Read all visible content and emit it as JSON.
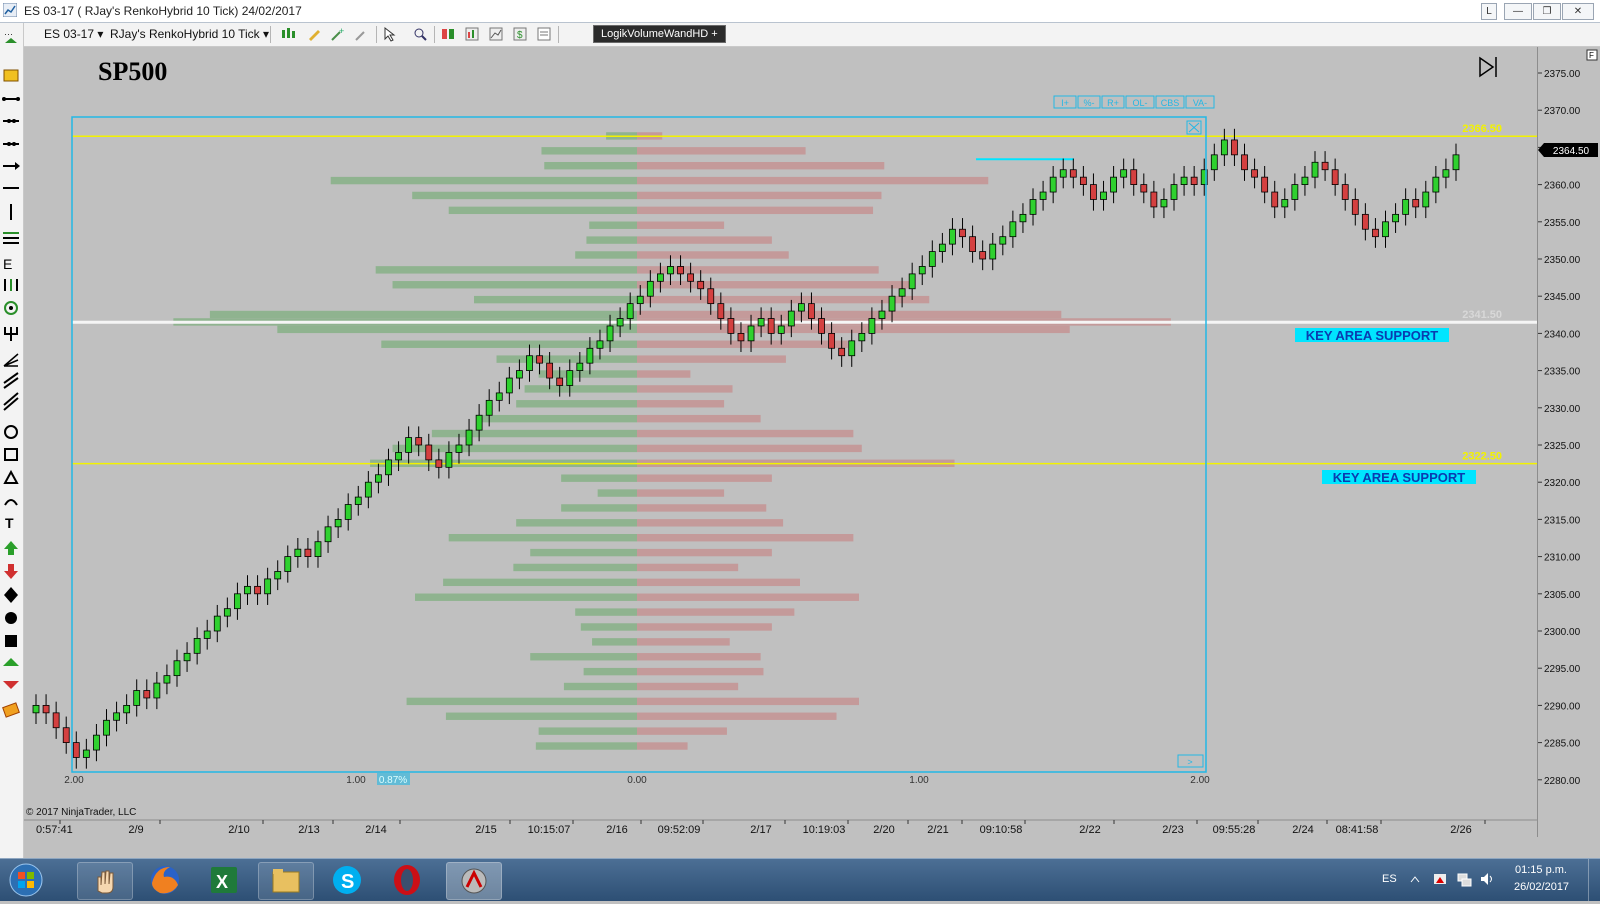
{
  "window": {
    "title": "ES 03-17 ( RJay's RenkoHybrid 10 Tick)  24/02/2017",
    "buttons": [
      "L",
      "—",
      "❐",
      "✕"
    ]
  },
  "toolbar": {
    "instrument": "ES 03-17",
    "bar_type": "RJay's RenkoHybrid 10 Tick",
    "indicator_button": "LogikVolumeWandHD +"
  },
  "colors": {
    "bull_candle": "#2fd12f",
    "bear_candle": "#d44040",
    "yellow_line": "#f2f200",
    "cyan_label": "#00e5ff",
    "profile_buy": "#8fb38f",
    "profile_sell": "#c49a9a",
    "box_border": "#23b7e5"
  },
  "chart": {
    "title": "SP500",
    "copyright": "© 2017 NinjaTrader, LLC",
    "y_axis_labels": [
      "2375.00",
      "2370.00",
      "2365.00",
      "2360.00",
      "2355.00",
      "2350.00",
      "2345.00",
      "2340.00",
      "2335.00",
      "2330.00",
      "2325.00",
      "2320.00",
      "2315.00",
      "2310.00",
      "2305.00",
      "2300.00",
      "2295.00",
      "2290.00",
      "2285.00",
      "2280.00"
    ],
    "y_range": [
      2280,
      2375
    ],
    "current_price": "2364.50",
    "levels": [
      {
        "price": 2366.5,
        "label": "2366.50",
        "color": "yellow"
      },
      {
        "price": 2341.5,
        "label": "2341.50",
        "color": "white"
      },
      {
        "price": 2322.5,
        "label": "2322.50",
        "color": "yellow"
      }
    ],
    "annotations": [
      "KEY AREA SUPPORT",
      "KEY AREA SUPPORT"
    ],
    "x_axis_labels": [
      "0:57:41",
      "2/9",
      "2/10",
      "2/13",
      "2/14",
      "2/15",
      "10:15:07",
      "2/16",
      "09:52:09",
      "2/17",
      "10:19:03",
      "2/20",
      "2/21",
      "09:10:58",
      "2/22",
      "2/23",
      "09:55:28",
      "2/24",
      "08:41:58",
      "2/26"
    ],
    "profile_buttons": [
      "I+",
      "%-",
      "R+",
      "OL-",
      "CBS",
      "VA-"
    ],
    "profile_scale_labels": [
      "2.00",
      "1.00",
      "0.87%",
      "0.00",
      "1.00",
      "2.00"
    ],
    "profile_nav": ">"
  },
  "chart_data": {
    "type": "candlestick",
    "title": "SP500",
    "ylim": [
      2280,
      2375
    ],
    "closes": [
      2290,
      2289,
      2287,
      2285,
      2283,
      2284,
      2286,
      2288,
      2289,
      2290,
      2292,
      2291,
      2293,
      2294,
      2296,
      2297,
      2299,
      2300,
      2302,
      2303,
      2305,
      2306,
      2305,
      2307,
      2308,
      2310,
      2311,
      2310,
      2312,
      2314,
      2315,
      2317,
      2318,
      2320,
      2321,
      2323,
      2324,
      2326,
      2325,
      2323,
      2322,
      2324,
      2325,
      2327,
      2329,
      2331,
      2332,
      2334,
      2335,
      2337,
      2336,
      2334,
      2333,
      2335,
      2336,
      2338,
      2339,
      2341,
      2342,
      2344,
      2345,
      2347,
      2348,
      2349,
      2348,
      2347,
      2346,
      2344,
      2342,
      2340,
      2339,
      2341,
      2342,
      2340,
      2341,
      2343,
      2344,
      2342,
      2340,
      2338,
      2337,
      2339,
      2340,
      2342,
      2343,
      2345,
      2346,
      2348,
      2349,
      2351,
      2352,
      2354,
      2353,
      2351,
      2350,
      2352,
      2353,
      2355,
      2356,
      2358,
      2359,
      2361,
      2362,
      2361,
      2360,
      2358,
      2359,
      2361,
      2362,
      2360,
      2359,
      2357,
      2358,
      2360,
      2361,
      2360,
      2362,
      2364,
      2366,
      2364,
      2362,
      2361,
      2359,
      2357,
      2358,
      2360,
      2361,
      2363,
      2362,
      2360,
      2358,
      2356,
      2354,
      2353,
      2355,
      2356,
      2358,
      2357,
      2359,
      2361,
      2362,
      2364
    ],
    "volume_profile": [
      {
        "price": 2366.5,
        "buy": 0.11,
        "sell": 0.09
      },
      {
        "price": 2364.5,
        "buy": 0.34,
        "sell": 0.6
      },
      {
        "price": 2362.5,
        "buy": 0.33,
        "sell": 0.88
      },
      {
        "price": 2360.5,
        "buy": 1.09,
        "sell": 1.25
      },
      {
        "price": 2358.5,
        "buy": 0.8,
        "sell": 0.87
      },
      {
        "price": 2356.5,
        "buy": 0.67,
        "sell": 0.84
      },
      {
        "price": 2354.5,
        "buy": 0.17,
        "sell": 0.31
      },
      {
        "price": 2352.5,
        "buy": 0.18,
        "sell": 0.48
      },
      {
        "price": 2350.5,
        "buy": 0.22,
        "sell": 0.54
      },
      {
        "price": 2348.5,
        "buy": 0.93,
        "sell": 0.86
      },
      {
        "price": 2346.5,
        "buy": 0.87,
        "sell": 0.97
      },
      {
        "price": 2344.5,
        "buy": 0.58,
        "sell": 1.04
      },
      {
        "price": 2342.5,
        "buy": 1.52,
        "sell": 1.51
      },
      {
        "price": 2341.5,
        "buy": 1.65,
        "sell": 1.9
      },
      {
        "price": 2340.5,
        "buy": 1.28,
        "sell": 1.54
      },
      {
        "price": 2338.5,
        "buy": 0.91,
        "sell": 0.75
      },
      {
        "price": 2336.5,
        "buy": 0.5,
        "sell": 0.53
      },
      {
        "price": 2334.5,
        "buy": 0.35,
        "sell": 0.19
      },
      {
        "price": 2332.5,
        "buy": 0.4,
        "sell": 0.34
      },
      {
        "price": 2330.5,
        "buy": 0.43,
        "sell": 0.31
      },
      {
        "price": 2328.5,
        "buy": 0.55,
        "sell": 0.44
      },
      {
        "price": 2326.5,
        "buy": 0.73,
        "sell": 0.77
      },
      {
        "price": 2324.5,
        "buy": 0.87,
        "sell": 0.8
      },
      {
        "price": 2322.5,
        "buy": 0.95,
        "sell": 1.13
      },
      {
        "price": 2320.5,
        "buy": 0.27,
        "sell": 0.48
      },
      {
        "price": 2318.5,
        "buy": 0.14,
        "sell": 0.31
      },
      {
        "price": 2316.5,
        "buy": 0.27,
        "sell": 0.46
      },
      {
        "price": 2314.5,
        "buy": 0.43,
        "sell": 0.52
      },
      {
        "price": 2312.5,
        "buy": 0.67,
        "sell": 0.77
      },
      {
        "price": 2310.5,
        "buy": 0.38,
        "sell": 0.48
      },
      {
        "price": 2308.5,
        "buy": 0.44,
        "sell": 0.36
      },
      {
        "price": 2306.5,
        "buy": 0.69,
        "sell": 0.58
      },
      {
        "price": 2304.5,
        "buy": 0.79,
        "sell": 0.79
      },
      {
        "price": 2302.5,
        "buy": 0.22,
        "sell": 0.56
      },
      {
        "price": 2300.5,
        "buy": 0.2,
        "sell": 0.48
      },
      {
        "price": 2298.5,
        "buy": 0.16,
        "sell": 0.33
      },
      {
        "price": 2296.5,
        "buy": 0.38,
        "sell": 0.44
      },
      {
        "price": 2294.5,
        "buy": 0.19,
        "sell": 0.45
      },
      {
        "price": 2292.5,
        "buy": 0.26,
        "sell": 0.36
      },
      {
        "price": 2290.5,
        "buy": 0.82,
        "sell": 0.79
      },
      {
        "price": 2288.5,
        "buy": 0.68,
        "sell": 0.71
      },
      {
        "price": 2286.5,
        "buy": 0.35,
        "sell": 0.32
      },
      {
        "price": 2284.5,
        "buy": 0.36,
        "sell": 0.18
      }
    ]
  }
}
